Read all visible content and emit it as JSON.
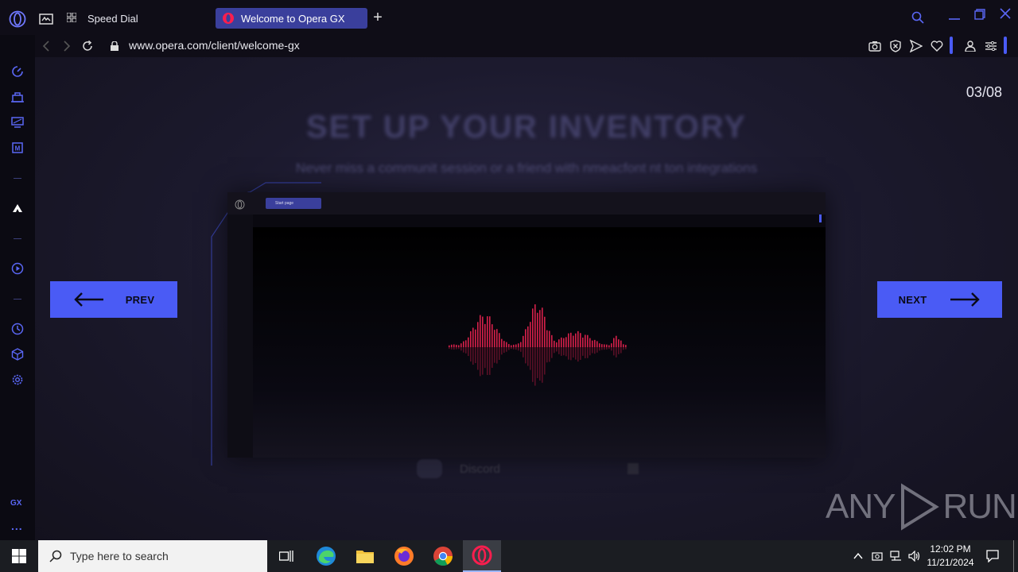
{
  "browser": {
    "tabs": [
      {
        "label": "Speed Dial",
        "active": false
      },
      {
        "label": "Welcome to Opera GX",
        "active": true
      }
    ],
    "address": "www.opera.com/client/welcome-gx",
    "accent_color": "#4a5bf5"
  },
  "sidebar": {
    "items": [
      "speed-dial-icon",
      "shop-icon",
      "monitor-icon",
      "memory-icon",
      "twitch-icon",
      "player-icon",
      "history-icon",
      "extensions-icon",
      "settings-icon"
    ],
    "gx_label": "GX",
    "more_label": "..."
  },
  "page": {
    "counter_current": "03",
    "counter_sep": "/",
    "counter_total": "08",
    "title": "SET UP YOUR INVENTORY",
    "subtitle": "Never miss a communit  session or a friend with  nmeacfont  nt ton  integrations",
    "prev_label": "PREV",
    "next_label": "NEXT",
    "mini_tab_label": "Start page",
    "discord_label": "Discord"
  },
  "watermark": {
    "text_left": "ANY",
    "text_right": "RUN"
  },
  "taskbar": {
    "search_placeholder": "Type here to search",
    "time": "12:02 PM",
    "date": "11/21/2024",
    "apps": [
      "task-view-icon",
      "edge-icon",
      "file-explorer-icon",
      "firefox-icon",
      "chrome-icon",
      "opera-gx-icon"
    ]
  }
}
